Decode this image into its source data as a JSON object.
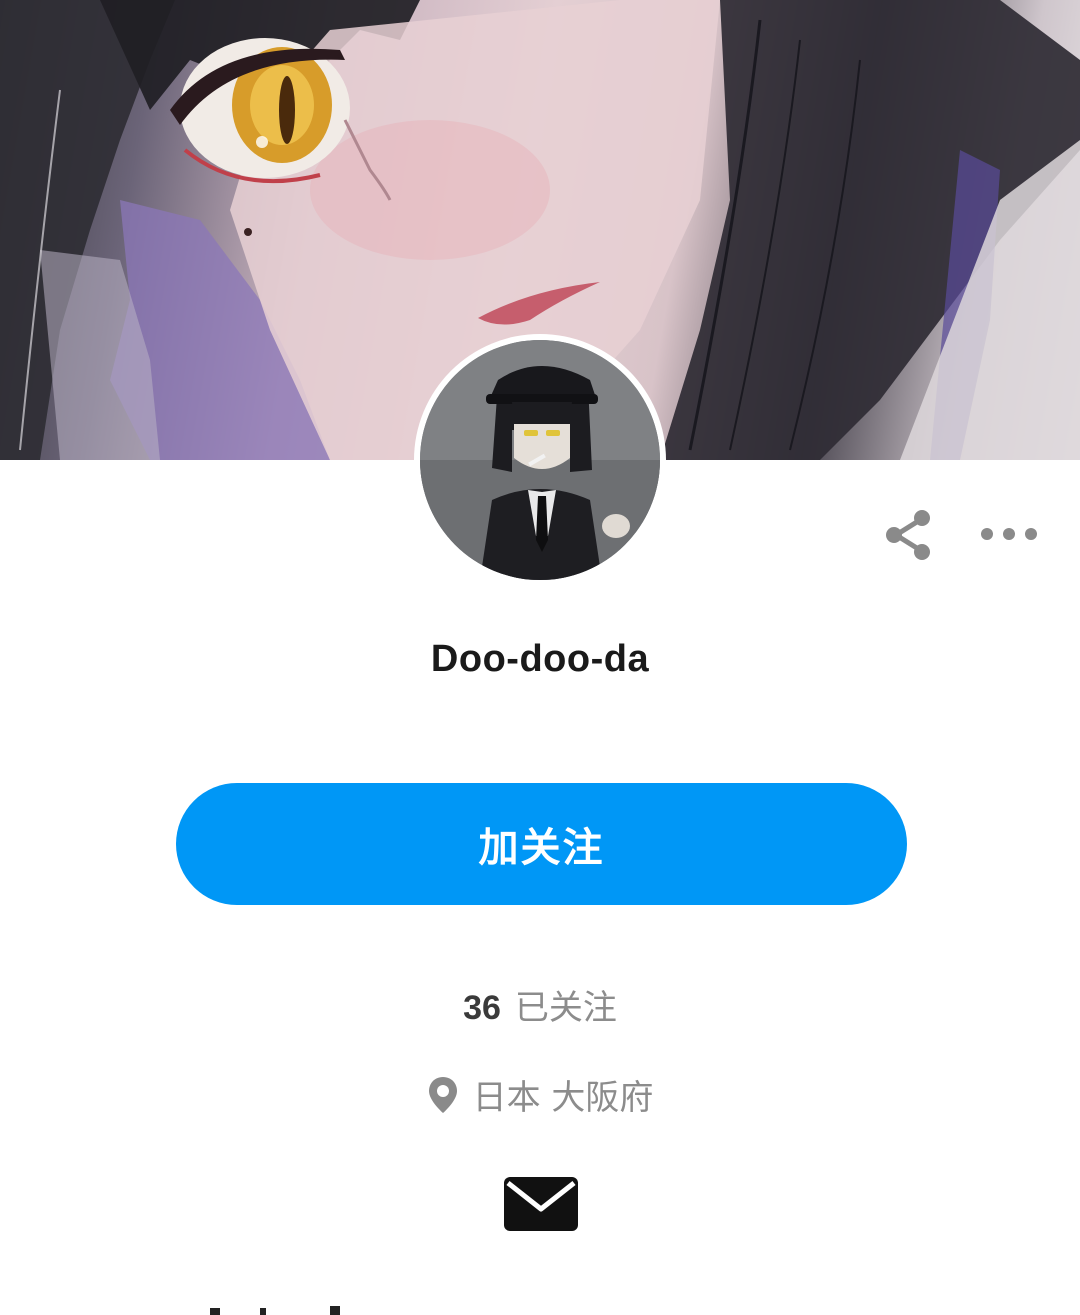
{
  "profile": {
    "username": "Doo-doo-da",
    "follow_label": "加关注",
    "following_count": "36",
    "following_label": "已关注",
    "location": "日本 大阪府"
  },
  "icons": {
    "share": "share-icon",
    "more": "more-icon",
    "location": "location-pin-icon",
    "mail": "mail-icon"
  },
  "colors": {
    "accent": "#0097f6",
    "name_text": "#1a1a1a",
    "meta_text": "#8c8c8c"
  }
}
